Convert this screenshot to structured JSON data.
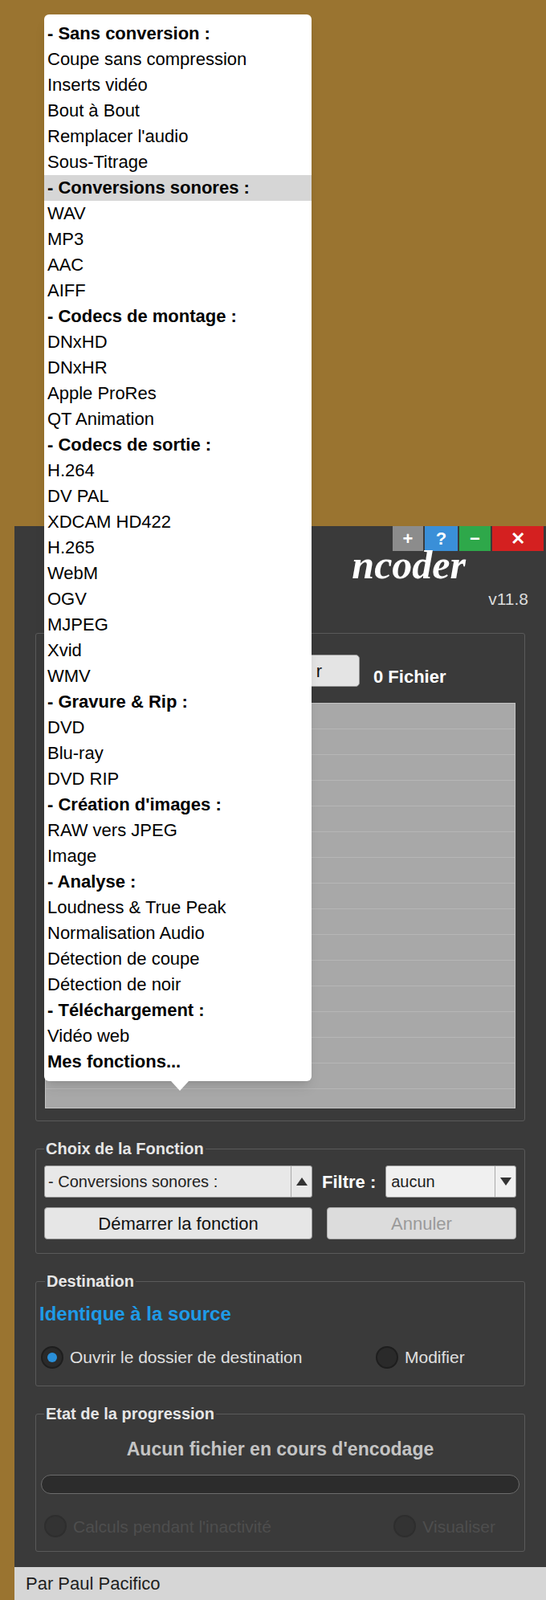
{
  "window": {
    "title_fragment": "ncoder",
    "version": "v11.8",
    "buttons": [
      {
        "label": "+",
        "color": "#8c8c8c"
      },
      {
        "label": "?",
        "color": "#3a8fd8"
      },
      {
        "label": "−",
        "color": "#2ea84a"
      },
      {
        "label": "✕",
        "color": "#d42020"
      }
    ]
  },
  "files": {
    "browse_button": "r",
    "count": "0 Fichier"
  },
  "function_menu": {
    "items": [
      {
        "label": "- Sans conversion :",
        "kind": "header",
        "selected": false
      },
      {
        "label": "Coupe sans compression",
        "kind": "item",
        "selected": false
      },
      {
        "label": "Inserts vidéo",
        "kind": "item",
        "selected": false
      },
      {
        "label": "Bout à Bout",
        "kind": "item",
        "selected": false
      },
      {
        "label": "Remplacer l'audio",
        "kind": "item",
        "selected": false
      },
      {
        "label": "Sous-Titrage",
        "kind": "item",
        "selected": false
      },
      {
        "label": "- Conversions sonores :",
        "kind": "header",
        "selected": true
      },
      {
        "label": "WAV",
        "kind": "item",
        "selected": false
      },
      {
        "label": "MP3",
        "kind": "item",
        "selected": false
      },
      {
        "label": "AAC",
        "kind": "item",
        "selected": false
      },
      {
        "label": "AIFF",
        "kind": "item",
        "selected": false
      },
      {
        "label": "- Codecs de montage :",
        "kind": "header",
        "selected": false
      },
      {
        "label": "DNxHD",
        "kind": "item",
        "selected": false
      },
      {
        "label": "DNxHR",
        "kind": "item",
        "selected": false
      },
      {
        "label": "Apple ProRes",
        "kind": "item",
        "selected": false
      },
      {
        "label": "QT Animation",
        "kind": "item",
        "selected": false
      },
      {
        "label": "- Codecs de sortie :",
        "kind": "header",
        "selected": false
      },
      {
        "label": "H.264",
        "kind": "item",
        "selected": false
      },
      {
        "label": "DV PAL",
        "kind": "item",
        "selected": false
      },
      {
        "label": "XDCAM HD422",
        "kind": "item",
        "selected": false
      },
      {
        "label": "H.265",
        "kind": "item",
        "selected": false
      },
      {
        "label": "WebM",
        "kind": "item",
        "selected": false
      },
      {
        "label": "OGV",
        "kind": "item",
        "selected": false
      },
      {
        "label": "MJPEG",
        "kind": "item",
        "selected": false
      },
      {
        "label": "Xvid",
        "kind": "item",
        "selected": false
      },
      {
        "label": "WMV",
        "kind": "item",
        "selected": false
      },
      {
        "label": "- Gravure & Rip :",
        "kind": "header",
        "selected": false
      },
      {
        "label": "DVD",
        "kind": "item",
        "selected": false
      },
      {
        "label": "Blu-ray",
        "kind": "item",
        "selected": false
      },
      {
        "label": "DVD RIP",
        "kind": "item",
        "selected": false
      },
      {
        "label": "- Création d'images :",
        "kind": "header",
        "selected": false
      },
      {
        "label": "RAW vers JPEG",
        "kind": "item",
        "selected": false
      },
      {
        "label": "Image",
        "kind": "item",
        "selected": false
      },
      {
        "label": "- Analyse :",
        "kind": "header",
        "selected": false
      },
      {
        "label": "Loudness & True Peak",
        "kind": "item",
        "selected": false
      },
      {
        "label": "Normalisation Audio",
        "kind": "item",
        "selected": false
      },
      {
        "label": "Détection de coupe",
        "kind": "item",
        "selected": false
      },
      {
        "label": "Détection de noir",
        "kind": "item",
        "selected": false
      },
      {
        "label": "- Téléchargement :",
        "kind": "header",
        "selected": false
      },
      {
        "label": "Vidéo web",
        "kind": "item",
        "selected": false
      },
      {
        "label": "Mes fonctions...",
        "kind": "header",
        "selected": false
      }
    ]
  },
  "function_choice": {
    "label": "Choix de la Fonction",
    "value": "- Conversions sonores :",
    "filter_label": "Filtre :",
    "filter_value": "aucun",
    "start_button": "Démarrer la fonction",
    "cancel_button": {
      "label": "Annuler",
      "disabled": true
    }
  },
  "destination": {
    "label": "Destination",
    "path": "Identique à la source",
    "options": [
      {
        "label": "Ouvrir le dossier de destination",
        "checked": true
      },
      {
        "label": "Modifier",
        "checked": false
      }
    ]
  },
  "progress": {
    "label": "Etat de la progression",
    "status": "Aucun fichier en cours d'encodage",
    "level": 0,
    "options": [
      {
        "label": "Calculs pendant l'inactivité",
        "checked": false,
        "disabled": true
      },
      {
        "label": "Visualiser",
        "checked": false,
        "disabled": true
      }
    ]
  },
  "footer": "Par Paul Pacifico"
}
